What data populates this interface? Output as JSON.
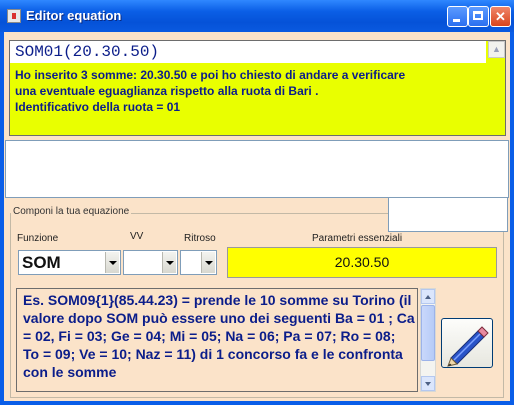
{
  "window": {
    "title": "Editor equation"
  },
  "formula": {
    "expression": "SOM01(20.30.50)",
    "description": "Ho inserito 3 somme: 20.30.50 e poi ho chiesto di andare a verificare\nuna eventuale eguaglianza rispetto alla ruota di Bari .\nIdentificativo della ruota = 01"
  },
  "composer": {
    "group_title": "Componi la tua equazione",
    "funzione_label": "Funzione",
    "funzione_value": "SOM",
    "vv_label": "VV",
    "vv_value": "",
    "ritroso_label": "Ritroso",
    "ritroso_value": "",
    "parametri_label": "Parametri essenziali",
    "parametri_value": "20.30.50"
  },
  "help": {
    "text": "Es. SOM09{1}(85.44.23) = prende le 10 somme su Torino  (il valore dopo SOM può essere uno dei seguenti  Ba = 01 ; Ca = 02, Fi = 03; Ge = 04; Mi = 05; Na = 06; Pa = 07; Ro = 08; To = 09; Ve = 10; Naz = 11) di 1 concorso fa e le confronta con le somme"
  },
  "colors": {
    "titlebar": "#0a5ee8",
    "formula_bg": "#e9ff00",
    "params_bg": "#ffff00",
    "text_blue": "#0b1d8a",
    "client_bg": "#fbe3c9"
  },
  "icons": {
    "edit": "pencil-icon",
    "app": "app-icon"
  }
}
